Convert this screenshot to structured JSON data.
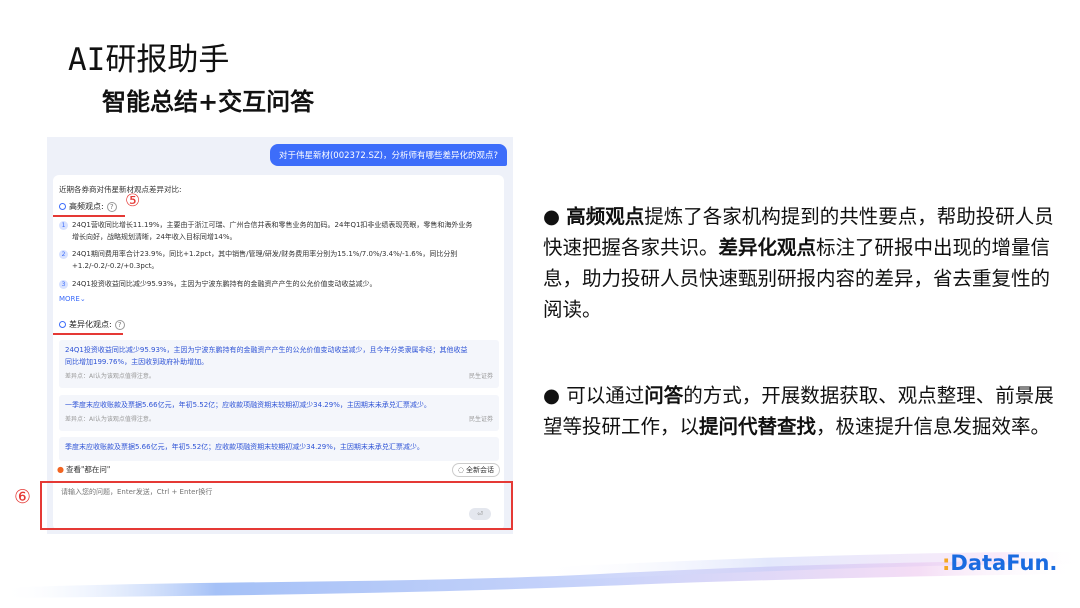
{
  "slide": {
    "title": "AI研报助手",
    "subtitle": "智能总结+交互问答"
  },
  "chat": {
    "question": "对于伟星新材(002372.SZ)，分析师有哪些差异化的观点?",
    "intro": "近期各券商对伟星新材观点差异对比:",
    "high_freq": {
      "label": "高频观点:",
      "help": "?",
      "marker": "⑤",
      "items": [
        {
          "num": "1",
          "line1": "24Q1营收同比增长11.19%，主要由于浙江可瑞、广州合信井表和零售业务的加码。24年Q1扣非业绩表现亮眼，零售和海外业务",
          "line2": "增长向好，战略规划清晰，24年收入目标同增14%。"
        },
        {
          "num": "2",
          "line1": "24Q1期间费用率合计23.9%，同比+1.2pct，其中销售/管理/研发/财务费用率分别为15.1%/7.0%/3.4%/-1.6%，同比分别",
          "line2": "+1.2/-0.2/-0.2/+0.3pct。"
        },
        {
          "num": "3",
          "line1": "24Q1投资收益同比减少95.93%，主因为宁波东鹏持有的金融资产产生的公允价值变动收益减少。",
          "line2": ""
        }
      ],
      "more": "MORE"
    },
    "diff": {
      "label": "差异化观点:",
      "help": "?",
      "cards": [
        {
          "text1": "24Q1投资收益同比减少95.93%，主因为宁波东鹏持有的金融资产产生的公允价值变动收益减少，且今年分类隶属非经；其他收益",
          "text2": "同比增加199.76%，主因收到政府补助增加。",
          "src_left": "差异点：AI认为该观点值得注意。",
          "src_right": "民生证券"
        },
        {
          "text1": "一季度末应收账款及票据5.66亿元，年初5.52亿；应收款项融资期末较期初减少34.29%，主因期末未承兑汇票减少。",
          "text2": "",
          "src_left": "差异点：AI认为该观点值得注意。",
          "src_right": "民生证券"
        },
        {
          "text1": "季度末应收账款及票据5.66亿元，年初5.52亿；应收款项融资期末较期初减少34.29%，主因期末未承兑汇票减少。",
          "text2": "",
          "src_left": "",
          "src_right": ""
        }
      ]
    },
    "footer": {
      "left": "查看\"都在问\"",
      "right": "全新会话"
    },
    "input": {
      "placeholder": "请输入您的问题，Enter发送，Ctrl + Enter换行"
    },
    "marker6": "⑥"
  },
  "right_text": {
    "p1": {
      "bullet": "● ",
      "b1": "高频观点",
      "t1": "提炼了各家机构提到的共性要点，帮助投研人员快速把握各家共识。",
      "b2": "差异化观点",
      "t2": "标注了研报中出现的增量信息，助力投研人员快速甄别研报内容的差异，省去重复性的阅读。"
    },
    "p2": {
      "bullet": "● ",
      "t1": "可以通过",
      "b1": "问答",
      "t2": "的方式，开展数据获取、观点整理、前景展望等投研工作，以",
      "b2": "提问代替查找",
      "t3": "，极速提升信息发掘效率。"
    }
  },
  "logo": {
    "dots": ":",
    "text": "DataFun."
  }
}
